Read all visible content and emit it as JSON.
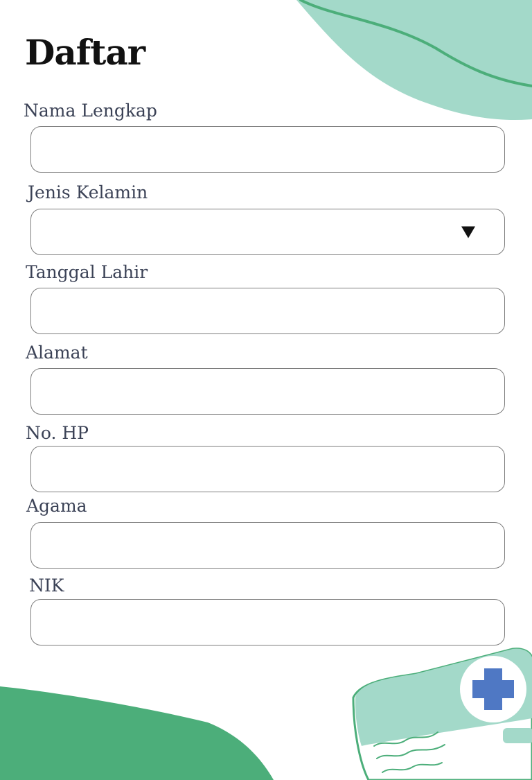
{
  "page": {
    "title": "Daftar"
  },
  "form": {
    "fields": [
      {
        "label": "Nama Lengkap",
        "value": "",
        "type": "text"
      },
      {
        "label": "Jenis Kelamin",
        "value": "",
        "type": "select"
      },
      {
        "label": "Tanggal Lahir",
        "value": "",
        "type": "text"
      },
      {
        "label": "Alamat",
        "value": "",
        "type": "text"
      },
      {
        "label": "No. HP",
        "value": "",
        "type": "text"
      },
      {
        "label": "Agama",
        "value": "",
        "type": "text"
      },
      {
        "label": "NIK",
        "value": "",
        "type": "text"
      }
    ]
  },
  "icons": {
    "dropdown": "caret-down-icon",
    "card": "health-card-icon",
    "card_symbol": "medical-cross-icon"
  },
  "colors": {
    "background": "#ffffff",
    "mint": "#a3d9c9",
    "green": "#4cae7a",
    "cross_blue": "#4f78c4",
    "label_text": "#3b4256",
    "title_text": "#111111",
    "field_border": "#7d7d7d"
  }
}
